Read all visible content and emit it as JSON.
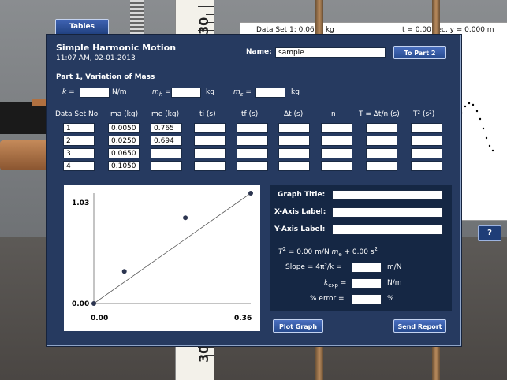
{
  "background": {
    "tables_button": "Tables",
    "ruler_labels": [
      "30",
      "30"
    ],
    "graph_panel_header": "Data Set 1: 0.0650 kg",
    "graph_panel_status": "t = 0.00 sec,  y = 0.000 m",
    "help_button": "?"
  },
  "panel": {
    "title": "Simple Harmonic Motion",
    "datetime": "11:07 AM, 02-01-2013",
    "name_label": "Name:",
    "name_value": "sample",
    "to_part2_button": "To Part 2",
    "section_title": "Part 1, Variation of Mass",
    "k_label": "k =",
    "k_unit": "N/m",
    "mh_label": "m",
    "mh_sub": "h",
    "mh_eq": "=",
    "mh_unit": "kg",
    "ms_label": "m",
    "ms_sub": "s",
    "ms_eq": "=",
    "ms_unit": "kg"
  },
  "table": {
    "headers": [
      "Data Set No.",
      "ma (kg)",
      "me (kg)",
      "ti (s)",
      "tf (s)",
      "Δt (s)",
      "n",
      "T = Δt/n (s)",
      "T² (s²)"
    ],
    "rows": [
      {
        "no": "1",
        "ma": "0.0050",
        "me": "0.765"
      },
      {
        "no": "2",
        "ma": "0.0250",
        "me": "0.694"
      },
      {
        "no": "3",
        "ma": "0.0650",
        "me": ""
      },
      {
        "no": "4",
        "ma": "0.1050",
        "me": ""
      }
    ]
  },
  "chart_data": {
    "type": "scatter",
    "x": [
      0.0,
      0.07,
      0.21,
      0.36
    ],
    "y": [
      0.0,
      0.3,
      0.8,
      1.03
    ],
    "xlim": [
      0,
      0.36
    ],
    "ylim": [
      0,
      1.03
    ],
    "tick_labels": {
      "xmin": "0.00",
      "xmax": "0.36",
      "ymin": "0.00",
      "ymax": "1.03"
    },
    "fit_line": true,
    "title": "",
    "xlabel": "",
    "ylabel": ""
  },
  "graph_form": {
    "graph_title_label": "Graph Title:",
    "x_axis_label": "X-Axis Label:",
    "y_axis_label": "Y-Axis Label:",
    "equation_t2": "T",
    "equation_mid": "=   0.00 m/N",
    "equation_me": "m",
    "equation_end": "+   0.00 s",
    "slope_label": "Slope = 4π²/k =",
    "slope_unit": "m/N",
    "kexp_label": "k",
    "kexp_sub": "exp",
    "kexp_eq": "=",
    "kexp_unit": "N/m",
    "error_label": "% error =",
    "error_unit": "%"
  },
  "buttons": {
    "plot_graph": "Plot Graph",
    "send_report": "Send Report"
  }
}
